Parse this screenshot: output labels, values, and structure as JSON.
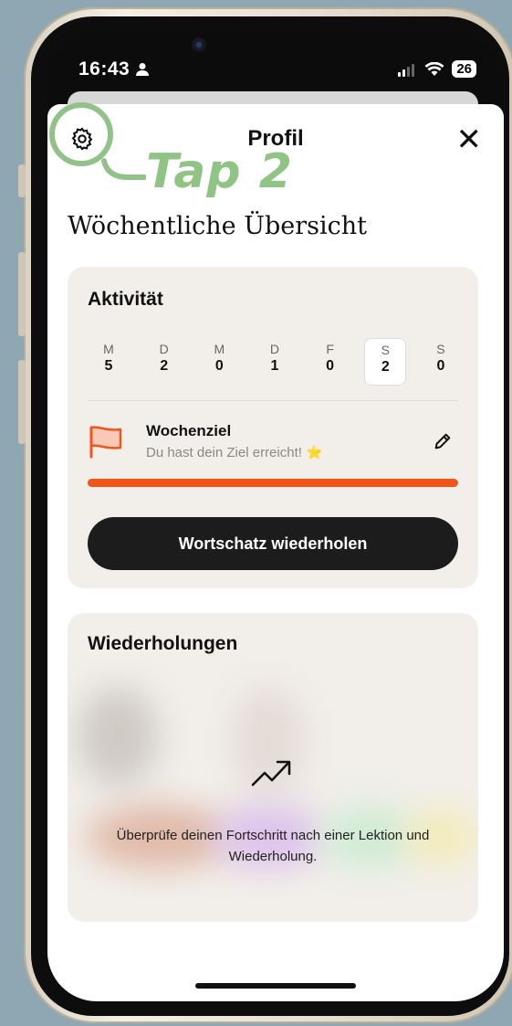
{
  "status_bar": {
    "time": "16:43",
    "battery": "26"
  },
  "header": {
    "title": "Profil"
  },
  "annotation": {
    "tap_label": "Tap 2"
  },
  "weekly": {
    "heading": "Wöchentliche Übersicht"
  },
  "activity": {
    "title": "Aktivität",
    "days": [
      {
        "label": "M",
        "value": "5"
      },
      {
        "label": "D",
        "value": "2"
      },
      {
        "label": "M",
        "value": "0"
      },
      {
        "label": "D",
        "value": "1"
      },
      {
        "label": "F",
        "value": "0"
      },
      {
        "label": "S",
        "value": "2",
        "active": true
      },
      {
        "label": "S",
        "value": "0"
      }
    ],
    "goal_title": "Wochenziel",
    "goal_subtitle": "Du hast dein Ziel erreicht! ⭐",
    "goal_progress": 1.0,
    "review_button": "Wortschatz wiederholen"
  },
  "reviews": {
    "title": "Wiederholungen",
    "text": "Überprüfe deinen Fortschritt nach einer Lektion und Wiederholung."
  },
  "colors": {
    "accent": "#f2551a",
    "highlight": "#92c28a"
  }
}
